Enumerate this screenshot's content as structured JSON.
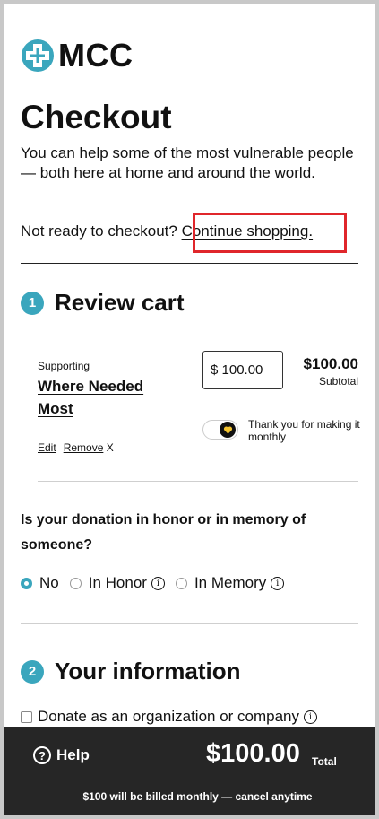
{
  "brand": {
    "name": "MCC",
    "accent": "#3aa6bd"
  },
  "header": {
    "title": "Checkout",
    "intro": "You can help some of the most vulnerable people — both here at home and around the world.",
    "not_ready": "Not ready to checkout?",
    "continue_link": "Continue shopping."
  },
  "review": {
    "step": "1",
    "title": "Review cart",
    "item": {
      "supporting_label": "Supporting",
      "fund_name": "Where Needed Most",
      "amount_value": "$ 100.00",
      "price": "$100.00",
      "subtotal_label": "Subtotal",
      "monthly_text": "Thank you for making it monthly",
      "edit": "Edit",
      "remove": "Remove",
      "remove_x": "X"
    }
  },
  "honor": {
    "question": "Is your donation in honor or in memory of someone?",
    "options": [
      {
        "label": "No",
        "selected": true
      },
      {
        "label": "In Honor",
        "selected": false
      },
      {
        "label": "In Memory",
        "selected": false
      }
    ]
  },
  "info": {
    "step": "2",
    "title": "Your information",
    "org_checkbox_label": "Donate as an organization or company"
  },
  "footer": {
    "help": "Help",
    "total_amount": "$100.00",
    "total_label": "Total",
    "billing_note": "$100 will be billed monthly — cancel anytime"
  },
  "colors": {
    "accent": "#3aa6bd",
    "highlight": "#e0262b",
    "footer_bg": "#262626"
  }
}
